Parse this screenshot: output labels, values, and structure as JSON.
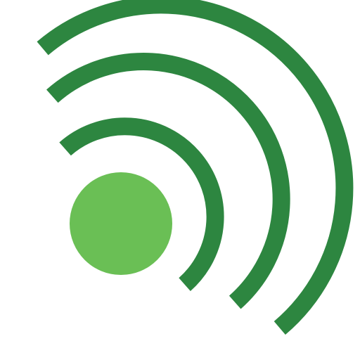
{
  "icon": {
    "name": "signal-broadcast-icon",
    "colors": {
      "background": "#ffffff",
      "dot": "#6abf55",
      "waves": "#2d8640"
    },
    "wave_count": 3
  }
}
